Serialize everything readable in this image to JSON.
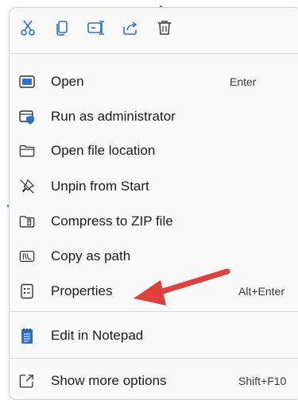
{
  "toolbar": {
    "buttons": [
      {
        "icon": "cut-icon"
      },
      {
        "icon": "copy-icon"
      },
      {
        "icon": "rename-icon"
      },
      {
        "icon": "share-icon"
      },
      {
        "icon": "delete-icon"
      }
    ]
  },
  "menu": {
    "items": [
      {
        "label": "Open",
        "shortcut": "Enter",
        "icon": "open-window-icon"
      },
      {
        "label": "Run as administrator",
        "shortcut": "",
        "icon": "shield-window-icon"
      },
      {
        "label": "Open file location",
        "shortcut": "",
        "icon": "folder-icon"
      },
      {
        "label": "Unpin from Start",
        "shortcut": "",
        "icon": "unpin-icon"
      },
      {
        "label": "Compress to ZIP file",
        "shortcut": "",
        "icon": "zip-folder-icon"
      },
      {
        "label": "Copy as path",
        "shortcut": "",
        "icon": "copy-path-icon"
      },
      {
        "label": "Properties",
        "shortcut": "Alt+Enter",
        "icon": "properties-icon"
      },
      {
        "label": "Edit in Notepad",
        "shortcut": "",
        "icon": "notepad-icon"
      },
      {
        "label": "Show more options",
        "shortcut": "Shift+F10",
        "icon": "more-options-icon"
      }
    ]
  },
  "colors": {
    "accent": "#0067c0",
    "annotation_arrow": "#e0403a"
  }
}
